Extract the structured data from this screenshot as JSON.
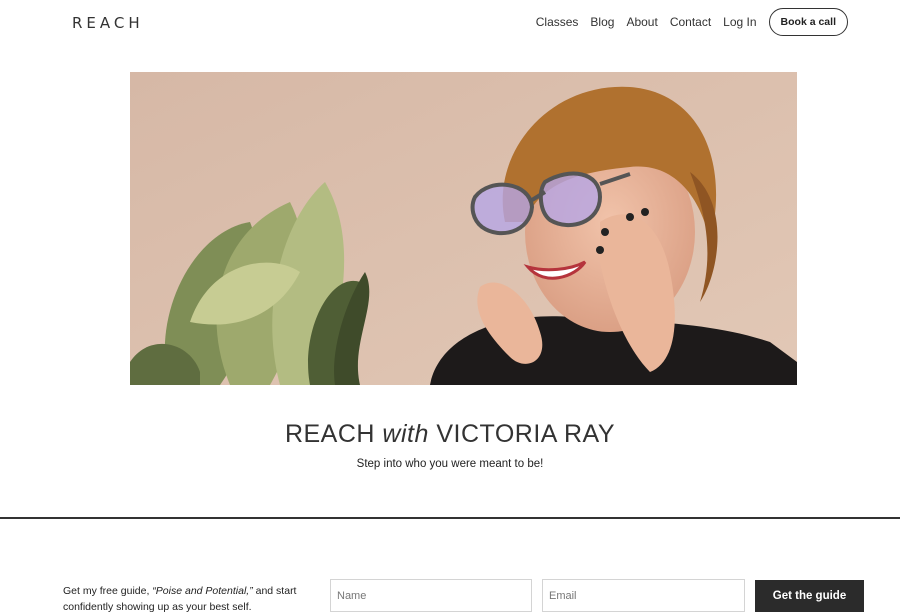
{
  "header": {
    "logo": "REACH",
    "nav": [
      {
        "label": "Classes"
      },
      {
        "label": "Blog"
      },
      {
        "label": "About"
      },
      {
        "label": "Contact"
      },
      {
        "label": "Log In"
      }
    ],
    "cta_label": "Book a call"
  },
  "hero": {
    "image": "smiling-woman-with-glasses-and-plant-photo"
  },
  "headline": {
    "part1": "REACH ",
    "part2": "with",
    "part3": " VICTORIA RAY",
    "subtitle": "Step into who you were meant to be!"
  },
  "signup": {
    "text_before": "Get my free guide, ",
    "guide_name": "“Poise and Potential,”",
    "text_after": " and start confidently showing up as your best self.",
    "name_placeholder": "Name",
    "email_placeholder": "Email",
    "button_label": "Get the guide"
  },
  "colors": {
    "hero_background": "#dcc0ae",
    "button_dark": "#2b2b2b"
  }
}
